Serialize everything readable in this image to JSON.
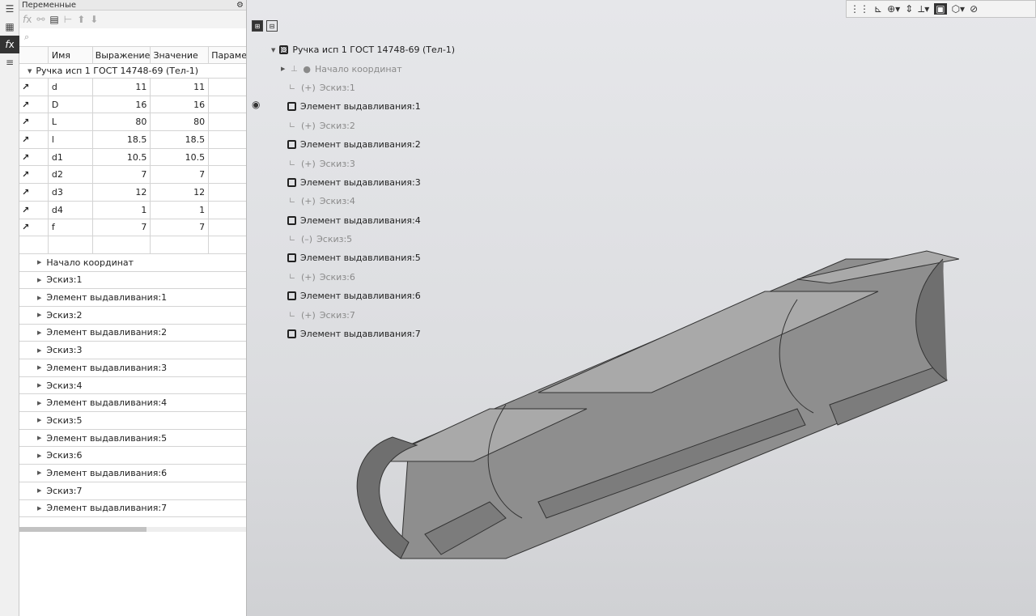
{
  "panel": {
    "title": "Переменные",
    "search_icon": "⌕",
    "columns": [
      "Имя",
      "Выражение",
      "Значение",
      "Парамет"
    ],
    "group_label": "Ручка исп 1 ГОСТ 14748-69 (Тел-1)",
    "variables": [
      {
        "name": "d",
        "expr": "11",
        "value": "11"
      },
      {
        "name": "D",
        "expr": "16",
        "value": "16"
      },
      {
        "name": "L",
        "expr": "80",
        "value": "80"
      },
      {
        "name": "l",
        "expr": "18.5",
        "value": "18.5"
      },
      {
        "name": "d1",
        "expr": "10.5",
        "value": "10.5"
      },
      {
        "name": "d2",
        "expr": "7",
        "value": "7"
      },
      {
        "name": "d3",
        "expr": "12",
        "value": "12"
      },
      {
        "name": "d4",
        "expr": "1",
        "value": "1"
      },
      {
        "name": "f",
        "expr": "7",
        "value": "7"
      }
    ],
    "tree_rows": [
      "Начало координат",
      "Эскиз:1",
      "Элемент выдавливания:1",
      "Эскиз:2",
      "Элемент выдавливания:2",
      "Эскиз:3",
      "Элемент выдавливания:3",
      "Эскиз:4",
      "Элемент выдавливания:4",
      "Эскиз:5",
      "Элемент выдавливания:5",
      "Эскиз:6",
      "Элемент выдавливания:6",
      "Эскиз:7",
      "Элемент выдавливания:7"
    ]
  },
  "model_tree": {
    "root": "Ручка исп 1 ГОСТ 14748-69 (Тел-1)",
    "origin": "Начало координат",
    "nodes": [
      {
        "type": "sketch",
        "label": "Эскиз:1",
        "prefix": "(+)"
      },
      {
        "type": "feature",
        "label": "Элемент выдавливания:1"
      },
      {
        "type": "sketch",
        "label": "Эскиз:2",
        "prefix": "(+)"
      },
      {
        "type": "feature",
        "label": "Элемент выдавливания:2"
      },
      {
        "type": "sketch",
        "label": "Эскиз:3",
        "prefix": "(+)"
      },
      {
        "type": "feature",
        "label": "Элемент выдавливания:3"
      },
      {
        "type": "sketch",
        "label": "Эскиз:4",
        "prefix": "(+)"
      },
      {
        "type": "feature",
        "label": "Элемент выдавливания:4"
      },
      {
        "type": "sketch",
        "label": "Эскиз:5",
        "prefix": "(–)"
      },
      {
        "type": "feature",
        "label": "Элемент выдавливания:5"
      },
      {
        "type": "sketch",
        "label": "Эскиз:6",
        "prefix": "(+)"
      },
      {
        "type": "feature",
        "label": "Элемент выдавливания:6"
      },
      {
        "type": "sketch",
        "label": "Эскиз:7",
        "prefix": "(+)"
      },
      {
        "type": "feature",
        "label": "Элемент выдавливания:7"
      }
    ]
  },
  "colors": {
    "panel_bg": "#ffffff",
    "viewport_bg": "#dcdde0",
    "model_face": "#8e8e8e",
    "model_dark": "#6f6f6f",
    "model_light": "#a9a9a9"
  }
}
